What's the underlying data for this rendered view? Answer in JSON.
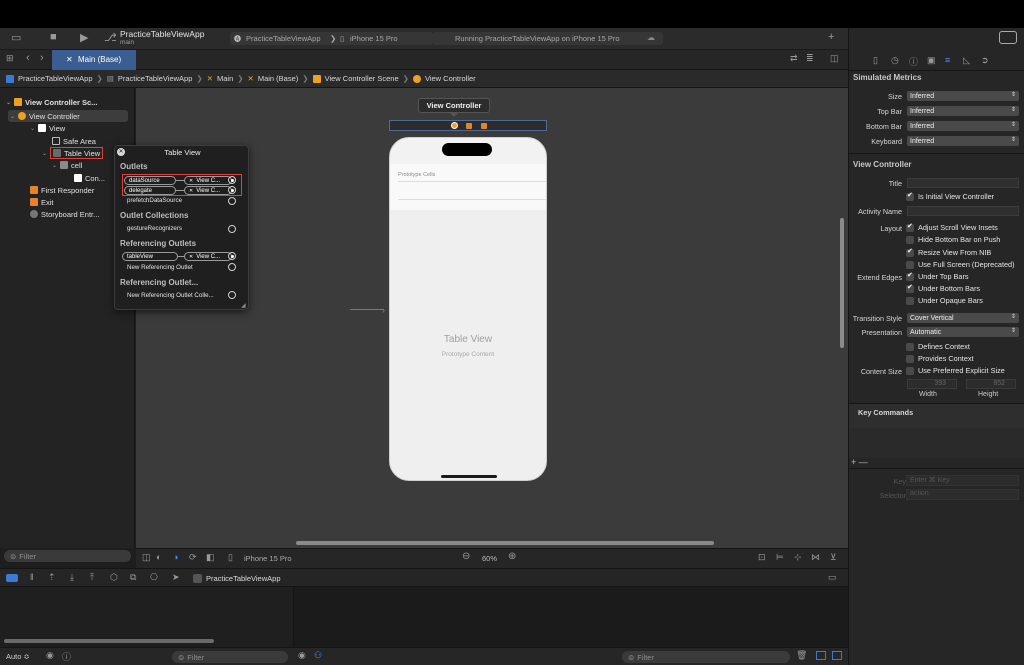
{
  "toolbar": {
    "app_name": "PracticeTableViewApp",
    "branch": "main",
    "scheme": "PracticeTableViewApp",
    "device": "iPhone 15 Pro",
    "status": "Running PracticeTableViewApp on iPhone 15 Pro"
  },
  "tab": {
    "label": "Main (Base)"
  },
  "breadcrumbs": [
    "PracticeTableViewApp",
    "PracticeTableViewApp",
    "Main",
    "Main (Base)",
    "View Controller Scene",
    "View Controller"
  ],
  "navigator": {
    "items": [
      {
        "label": "View Controller Sc..."
      },
      {
        "label": "View Controller"
      },
      {
        "label": "View"
      },
      {
        "label": "Safe Area"
      },
      {
        "label": "Table View"
      },
      {
        "label": "cell"
      },
      {
        "label": "Con..."
      },
      {
        "label": "First Responder"
      },
      {
        "label": "Exit"
      },
      {
        "label": "Storyboard Entr..."
      }
    ],
    "filter_placeholder": "Filter"
  },
  "scene": {
    "title_tooltip": "View Controller"
  },
  "phone": {
    "section_label": "Prototype Cells",
    "table_title": "Table View",
    "table_subtitle": "Prototype Content"
  },
  "popover": {
    "title": "Table View",
    "sections": {
      "outlets": "Outlets",
      "outlet_collections": "Outlet Collections",
      "referencing_outlets": "Referencing Outlets",
      "referencing_outlet_collections": "Referencing Outlet..."
    },
    "connections": {
      "data_source": "dataSource",
      "data_source_target": "View C...",
      "delegate": "delegate",
      "delegate_target": "View C...",
      "prefetch": "prefetchDataSource",
      "gesture": "gestureRecognizers",
      "table_view": "tableView",
      "table_view_target": "View C...",
      "new_ref": "New Referencing Outlet",
      "new_ref_collection": "New Referencing Outlet Colle..."
    }
  },
  "bottom_bar": {
    "device": "iPhone 15 Pro",
    "zoom": "60%"
  },
  "debug_bar": {
    "target": "PracticeTableViewApp"
  },
  "footer": {
    "auto": "Auto ≎",
    "filter_left": "Filter",
    "filter_right": "Filter"
  },
  "inspector": {
    "simulated_metrics": "Simulated Metrics",
    "size_label": "Size",
    "size_value": "Inferred",
    "topbar_label": "Top Bar",
    "topbar_value": "Inferred",
    "bottombar_label": "Bottom Bar",
    "bottombar_value": "Inferred",
    "keyboard_label": "Keyboard",
    "keyboard_value": "Inferred",
    "view_controller": "View Controller",
    "title_label": "Title",
    "initial_vc": "Is Initial View Controller",
    "activity_label": "Activity Name",
    "layout_label": "Layout",
    "adjust_insets": "Adjust Scroll View Insets",
    "hide_bottom": "Hide Bottom Bar on Push",
    "resize_nib": "Resize View From NIB",
    "full_screen": "Use Full Screen (Deprecated)",
    "extend_label": "Extend Edges",
    "under_top": "Under Top Bars",
    "under_bottom": "Under Bottom Bars",
    "under_opaque": "Under Opaque Bars",
    "transition_label": "Transition Style",
    "transition_value": "Cover Vertical",
    "presentation_label": "Presentation",
    "presentation_value": "Automatic",
    "defines_context": "Defines Context",
    "provides_context": "Provides Context",
    "content_size_label": "Content Size",
    "preferred_size": "Use Preferred Explicit Size",
    "width_value": "393",
    "height_value": "852",
    "width_label": "Width",
    "height_label": "Height",
    "key_commands": "Key Commands",
    "key_label": "Key",
    "key_placeholder": "Enter ⌘ Key",
    "selector_label": "Selector",
    "selector_placeholder": "action",
    "add_remove": "+ —"
  }
}
